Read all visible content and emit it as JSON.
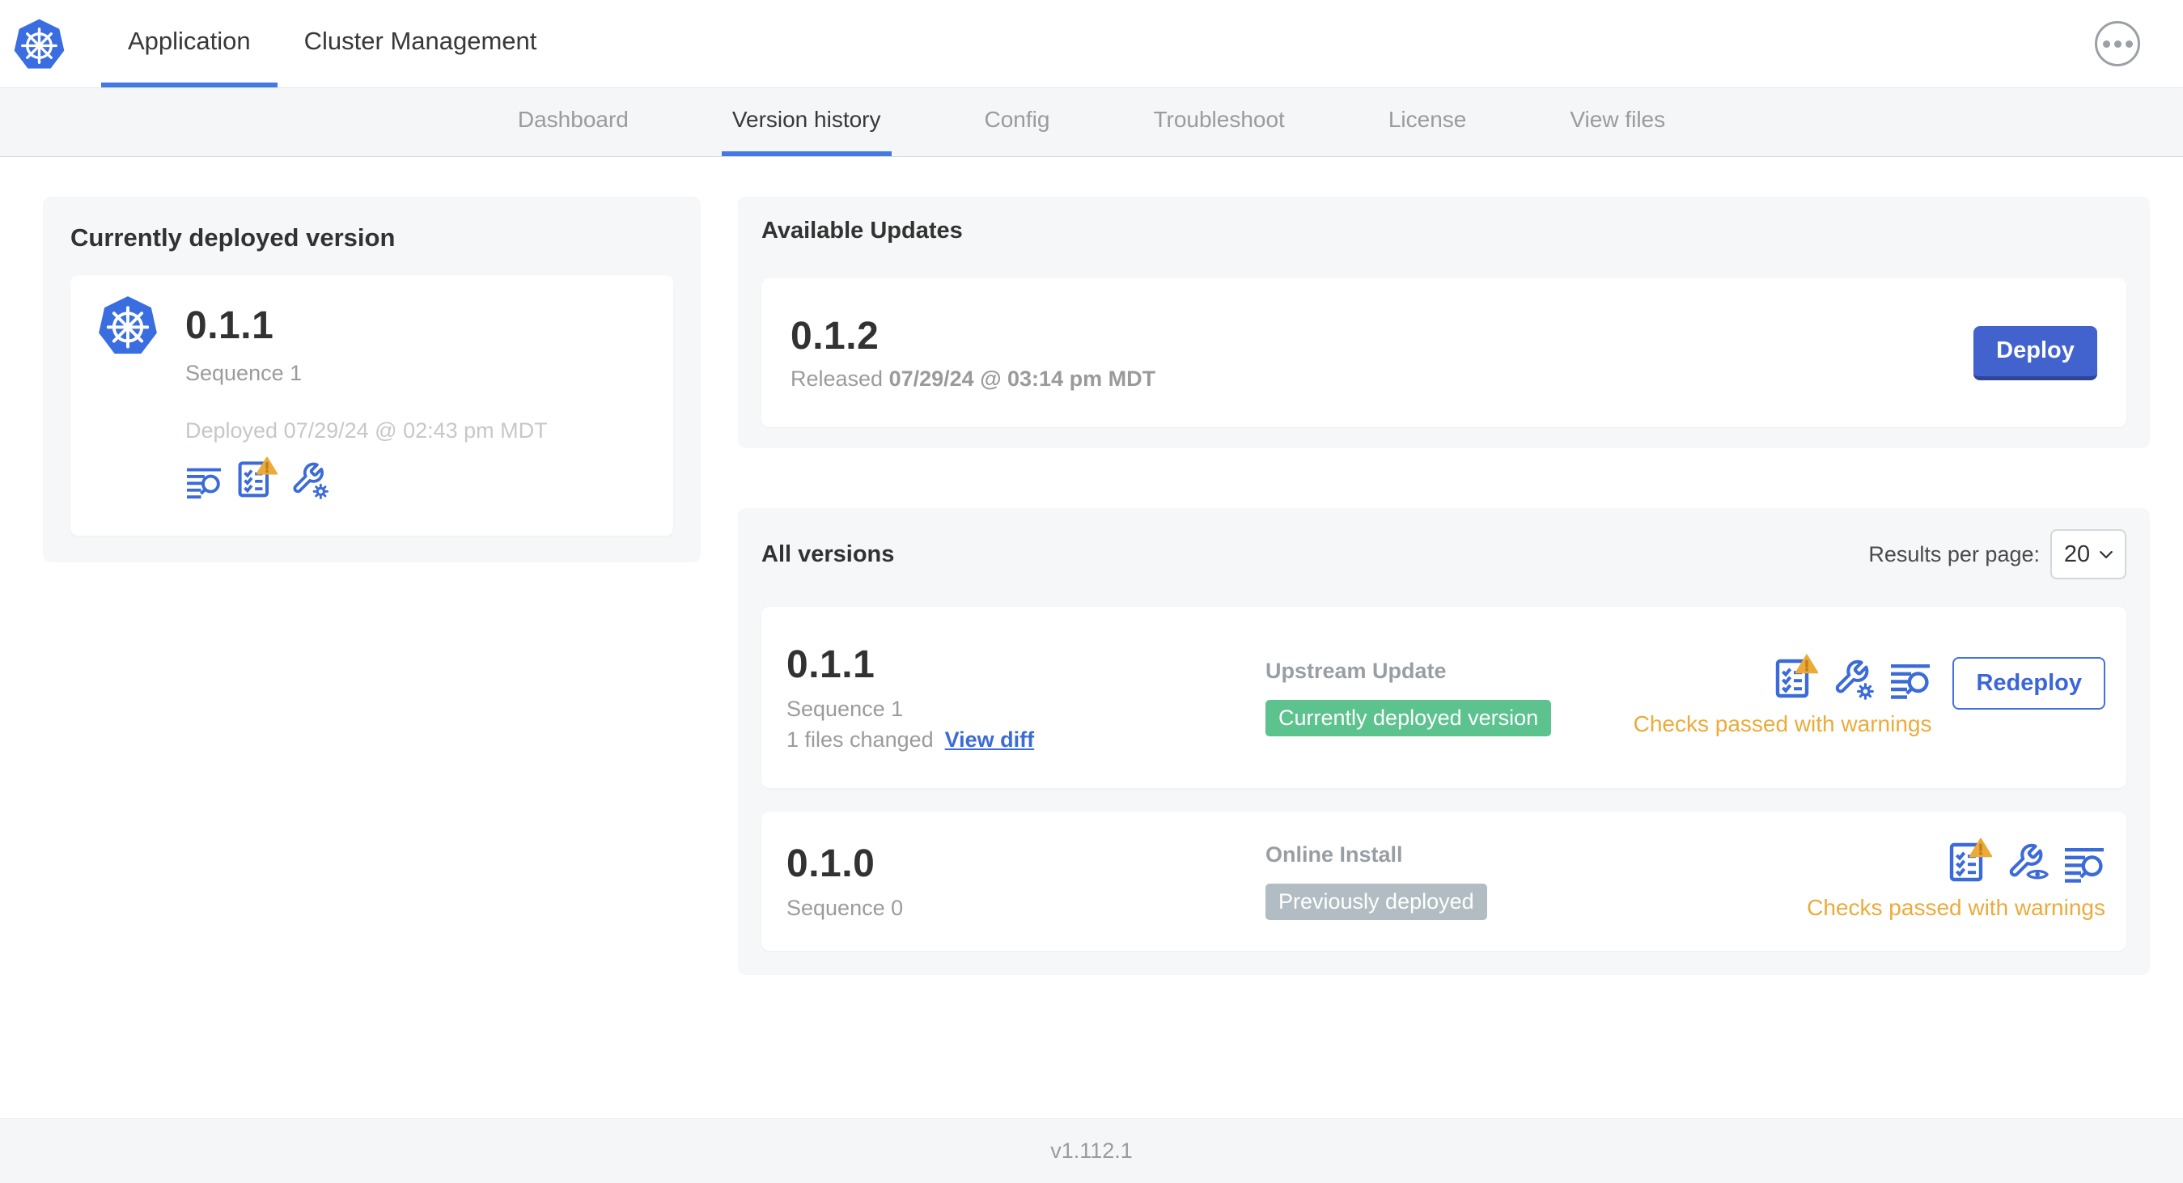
{
  "header": {
    "tabs": [
      {
        "label": "Application"
      },
      {
        "label": "Cluster Management"
      }
    ],
    "menu_icon": "ellipsis-icon"
  },
  "subnav": {
    "tabs": [
      {
        "label": "Dashboard"
      },
      {
        "label": "Version history"
      },
      {
        "label": "Config"
      },
      {
        "label": "Troubleshoot"
      },
      {
        "label": "License"
      },
      {
        "label": "View files"
      }
    ],
    "active_tab": "Version history"
  },
  "current_version": {
    "title": "Currently deployed version",
    "version": "0.1.1",
    "sequence": "Sequence 1",
    "deployed": "Deployed 07/29/24 @ 02:43 pm MDT",
    "icons": [
      "file-search-icon",
      "preflight-checklist-warning-icon",
      "config-wrench-gear-icon"
    ]
  },
  "available_updates": {
    "title": "Available Updates",
    "version": "0.1.2",
    "released_label": "Released",
    "released_date": "07/29/24 @ 03:14 pm MDT",
    "deploy_button": "Deploy"
  },
  "all_versions": {
    "title": "All versions",
    "results_per_page_label": "Results per page:",
    "results_per_page_value": "20",
    "rows": [
      {
        "version": "0.1.1",
        "sequence": "Sequence 1",
        "files_changed": "1 files changed",
        "view_diff_link": "View diff",
        "source": "Upstream Update",
        "badge": "Currently deployed version",
        "badge_color": "#5cc28e",
        "icons": [
          "preflight-checklist-warning-icon",
          "config-wrench-gear-icon",
          "file-search-icon"
        ],
        "checks_status": "Checks passed with warnings",
        "action_button": "Redeploy"
      },
      {
        "version": "0.1.0",
        "sequence": "Sequence 0",
        "source": "Online Install",
        "badge": "Previously deployed",
        "badge_color": "#b2bdc3",
        "icons": [
          "preflight-checklist-warning-icon",
          "config-wrench-eye-icon",
          "file-search-icon"
        ],
        "checks_status": "Checks passed with warnings"
      }
    ]
  },
  "footer": {
    "version": "v1.112.1"
  },
  "colors": {
    "accent_blue": "#3b6bd8",
    "deploy_button_blue": "#4263cd",
    "warning_orange": "#ecab3b",
    "badge_green": "#5cc28e",
    "badge_gray": "#b2bdc3",
    "k8s_logo_blue": "#3a6de0",
    "subnav_bg": "#f4f6f7",
    "card_bg": "#f5f7f8"
  }
}
